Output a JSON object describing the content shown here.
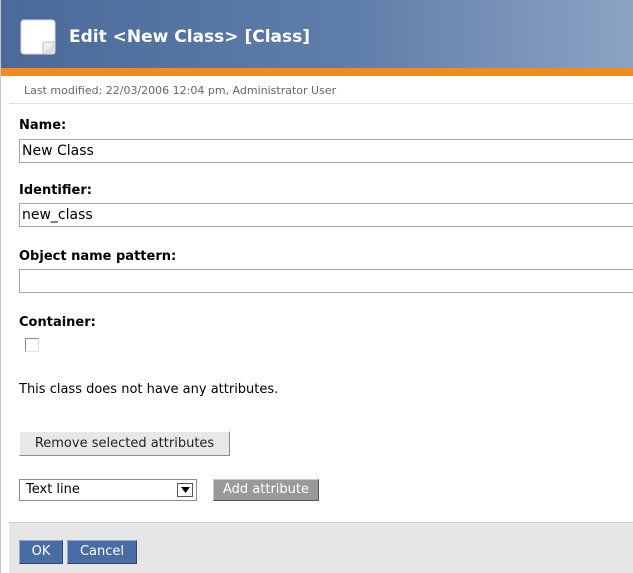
{
  "header": {
    "title": "Edit <New Class> [Class]",
    "icon": "document-icon"
  },
  "meta": {
    "last_modified": "Last modified: 22/03/2006 12:04 pm, Administrator User"
  },
  "fields": {
    "name": {
      "label": "Name:",
      "value": "New Class"
    },
    "identifier": {
      "label": "Identifier:",
      "value": "new_class"
    },
    "object_name_pattern": {
      "label": "Object name pattern:",
      "value": ""
    },
    "container": {
      "label": "Container:",
      "checked": false
    }
  },
  "attributes": {
    "empty_message": "This class does not have any attributes.",
    "remove_button": "Remove selected attributes",
    "datatype_select": {
      "selected": "Text line"
    },
    "add_button": "Add attribute"
  },
  "footer": {
    "ok_label": "OK",
    "cancel_label": "Cancel"
  },
  "colors": {
    "header_blue": "#4c6a99",
    "accent_orange": "#f18c1c",
    "button_blue": "#4a6ca5",
    "disabled_gray": "#999999"
  }
}
